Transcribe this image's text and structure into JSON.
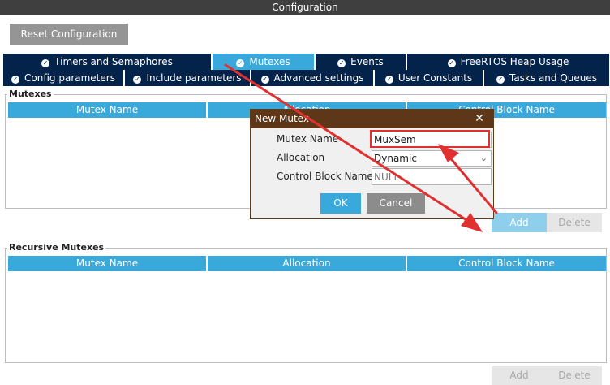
{
  "window": {
    "title": "Configuration"
  },
  "toolbar": {
    "reset_label": "Reset Configuration"
  },
  "tabs_row1": [
    {
      "label": "Timers and Semaphores",
      "active": false
    },
    {
      "label": "Mutexes",
      "active": true
    },
    {
      "label": "Events",
      "active": false
    },
    {
      "label": "FreeRTOS Heap Usage",
      "active": false
    }
  ],
  "tabs_row2": [
    {
      "label": "Config parameters"
    },
    {
      "label": "Include parameters"
    },
    {
      "label": "Advanced settings"
    },
    {
      "label": "User Constants"
    },
    {
      "label": "Tasks and Queues"
    }
  ],
  "mutexes": {
    "legend": "Mutexes",
    "columns": [
      "Mutex Name",
      "Allocation",
      "Control Block Name"
    ],
    "add_label": "Add",
    "delete_label": "Delete"
  },
  "recursive_mutexes": {
    "legend": "Recursive Mutexes",
    "columns": [
      "Mutex Name",
      "Allocation",
      "Control Block Name"
    ],
    "add_label": "Add",
    "delete_label": "Delete"
  },
  "dialog": {
    "title": "New Mutex",
    "close_glyph": "✕",
    "mutex_name_label": "Mutex Name",
    "mutex_name_value": "MuxSem",
    "allocation_label": "Allocation",
    "allocation_value": "Dynamic",
    "control_block_label": "Control Block Name",
    "control_block_placeholder": "NULL",
    "ok_label": "OK",
    "cancel_label": "Cancel"
  },
  "annotation": {
    "highlight_color": "#e03030"
  }
}
